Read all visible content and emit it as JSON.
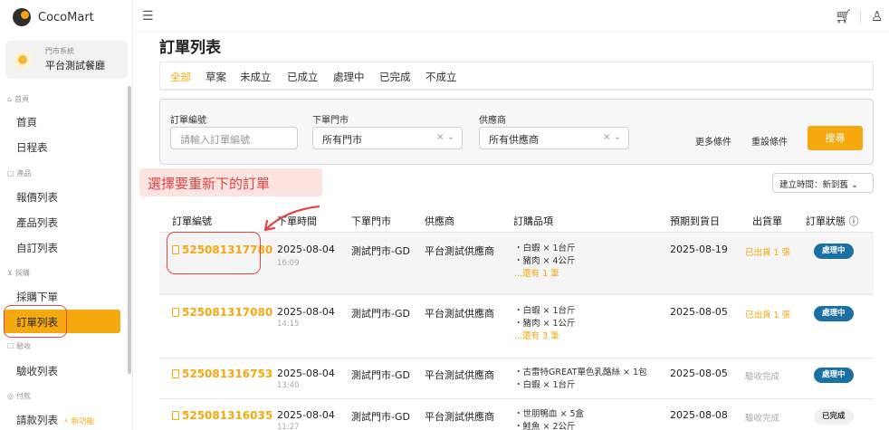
{
  "app": {
    "name": "CocoMart"
  },
  "store": {
    "system": "門市系統",
    "name": "平台測試餐廳"
  },
  "sidebar": {
    "sections": [
      {
        "label": "首頁",
        "icon": "home-icon"
      },
      {
        "label": "產品",
        "icon": "box-icon"
      },
      {
        "label": "採購",
        "icon": "cart-icon"
      },
      {
        "label": "驗收",
        "icon": "check-icon"
      },
      {
        "label": "付款",
        "icon": "dollar-icon"
      }
    ],
    "items": [
      "首頁",
      "日程表",
      "報價列表",
      "產品列表",
      "自訂列表",
      "採購下單",
      "訂單列表",
      "驗收列表",
      "請款列表"
    ],
    "new_badge": "⚡ 新功能"
  },
  "page": {
    "title": "訂單列表"
  },
  "tabs": [
    "全部",
    "草案",
    "未成立",
    "已成立",
    "處理中",
    "已完成",
    "不成立"
  ],
  "filters": {
    "order_no_label": "訂單編號",
    "order_no_placeholder": "請輸入訂單編號",
    "store_label": "下單門市",
    "store_value": "所有門市",
    "supplier_label": "供應商",
    "supplier_value": "所有供應商",
    "more": "更多條件",
    "reset": "重設條件",
    "search": "搜尋"
  },
  "annotation": "選擇要重新下的訂單",
  "sort": "建立時間：新到舊",
  "table": {
    "headers": [
      "訂單編號",
      "下單時間",
      "下單門市",
      "供應商",
      "訂購品項",
      "預期到貨日",
      "出貨單",
      "訂單狀態"
    ],
    "rows": [
      {
        "no": "525081317780",
        "date": "2025-08-04",
        "time": "16:09",
        "store": "測試門市-GD",
        "supplier": "平台測試供應商",
        "items": [
          "・白蝦 × 1台斤",
          "・豬肉 × 4公斤"
        ],
        "more": "...還有 1 筆",
        "eta": "2025-08-19",
        "ship": "已出貨 1 張",
        "status": "處理中"
      },
      {
        "no": "525081317080",
        "date": "2025-08-04",
        "time": "14:15",
        "store": "測試門市-GD",
        "supplier": "平台測試供應商",
        "items": [
          "・白蝦 × 1台斤",
          "・豬肉 × 1公斤"
        ],
        "more": "...還有 3 筆",
        "eta": "2025-08-05",
        "ship": "已出貨 1 張",
        "status": "處理中"
      },
      {
        "no": "525081316753",
        "date": "2025-08-04",
        "time": "13:40",
        "store": "測試門市-GD",
        "supplier": "平台測試供應商",
        "items": [
          "・古雷特GREAT單色乳酪絲 × 1包",
          "・白蝦 × 1台斤"
        ],
        "more": "",
        "eta": "2025-08-05",
        "ship": "驗收完成",
        "status": "處理中"
      },
      {
        "no": "525081316035",
        "date": "2025-08-04",
        "time": "11:27",
        "store": "測試門市-GD",
        "supplier": "平台測試供應商",
        "items": [
          "・世朋鴨血 × 5盒",
          "・鮭魚 × 2公斤"
        ],
        "more": "",
        "eta": "2025-08-08",
        "ship": "驗收完成",
        "status": "已完成"
      }
    ]
  },
  "colors": {
    "accent": "#f5a90f",
    "status_blue": "#1a6fa5",
    "annotation_red": "#df4343"
  }
}
